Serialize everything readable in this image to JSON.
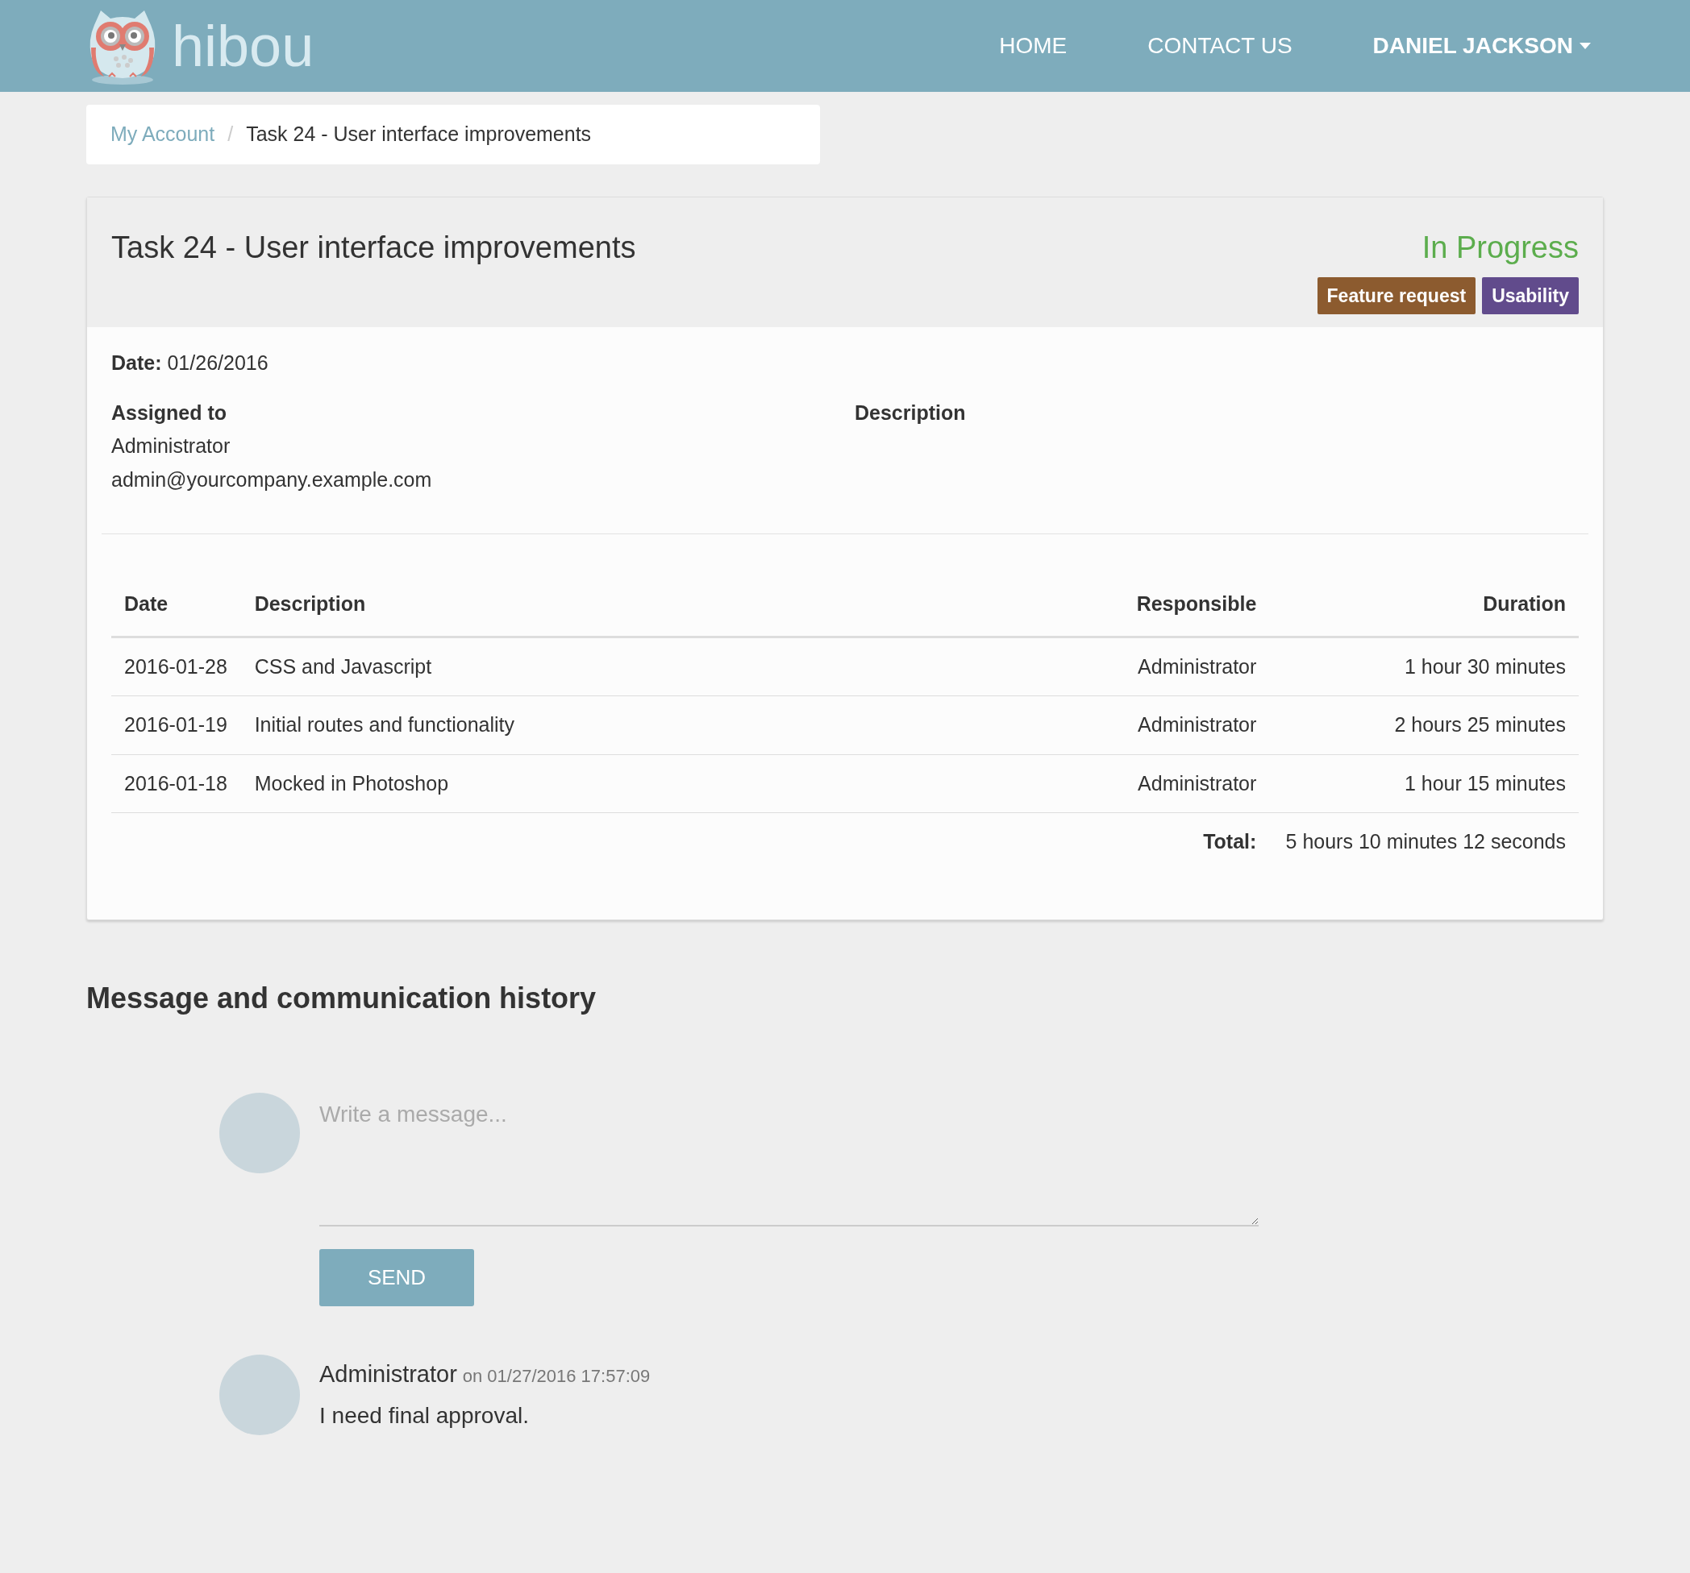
{
  "navbar": {
    "brand": "hibou",
    "links": [
      {
        "label": "HOME",
        "kind": "link"
      },
      {
        "label": "CONTACT US",
        "kind": "link"
      },
      {
        "label": "DANIEL JACKSON",
        "kind": "dropdown"
      }
    ]
  },
  "breadcrumb_separator": "/",
  "breadcrumb": [
    {
      "label": "My Account",
      "kind": "link"
    },
    {
      "label": "Task 24 - User interface improvements",
      "kind": "current"
    }
  ],
  "task": {
    "title": "Task 24 - User interface improvements",
    "status": "In Progress",
    "tags": [
      {
        "label": "Feature request",
        "color": "#8c5b2f"
      },
      {
        "label": "Usability",
        "color": "#614b8c"
      }
    ],
    "date_label": "Date:",
    "date": "01/26/2016",
    "assigned_label": "Assigned to",
    "assignee": "Administrator",
    "assignee_email": "admin@yourcompany.example.com",
    "description_label": "Description",
    "timesheet": {
      "columns": [
        "Date",
        "Description",
        "Responsible",
        "Duration"
      ],
      "rows": [
        {
          "date": "2016-01-28",
          "description": "CSS and Javascript",
          "responsible": "Administrator",
          "duration": "1 hour 30 minutes"
        },
        {
          "date": "2016-01-19",
          "description": "Initial routes and functionality",
          "responsible": "Administrator",
          "duration": "2 hours 25 minutes"
        },
        {
          "date": "2016-01-18",
          "description": "Mocked in Photoshop",
          "responsible": "Administrator",
          "duration": "1 hour 15 minutes"
        }
      ],
      "total_label": "Total:",
      "total": "5 hours 10 minutes 12 seconds"
    }
  },
  "messages_section": {
    "title": "Message and communication history",
    "composer": {
      "placeholder": "Write a message...",
      "send": "SEND"
    },
    "messages": [
      {
        "author": "Administrator",
        "meta": "on 01/27/2016 17:57:09",
        "body": "I need final approval."
      }
    ]
  }
}
